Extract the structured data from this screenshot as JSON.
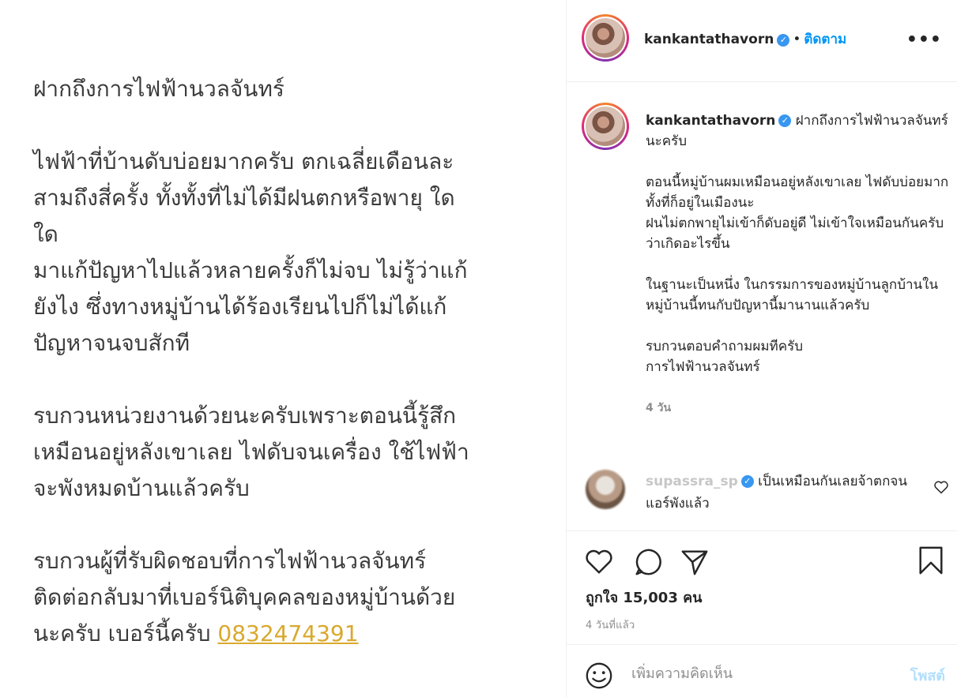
{
  "post_image": {
    "lines": [
      "ฝากถึงการไฟฟ้านวลจันทร์",
      "ไฟฟ้าที่บ้านดับบ่อยมากครับ ตกเฉลี่ยเดือนละ\nสามถึงสี่ครั้ง ทั้งทั้งที่ไม่ได้มีฝนตกหรือพายุ ใด\nใด\nมาแก้ปัญหาไปแล้วหลายครั้งก็ไม่จบ ไม่รู้ว่าแก้\nยังไง ซึ่งทางหมู่บ้านได้ร้องเรียนไปก็ไม่ได้แก้\nปัญหาจนจบสักที",
      "รบกวนหน่วยงานด้วยนะครับเพราะตอนนี้รู้สึก\nเหมือนอยู่หลังเขาเลย ไฟดับจนเครื่อง ใช้ไฟฟ้า\nจะพังหมดบ้านแล้วครับ",
      "รบกวนผู้ที่รับผิดชอบที่การไฟฟ้านวลจันทร์\nติดต่อกลับมาที่เบอร์นิติบุคคลของหมู่บ้านด้วย\nนะครับ เบอร์นี้ครับ "
    ],
    "phone": "0832474391"
  },
  "header": {
    "username": "kankantathavorn",
    "verified": "✓",
    "dot": "•",
    "follow_label": "ติดตาม",
    "more": "•••"
  },
  "caption": {
    "username": "kankantathavorn",
    "verified": "✓",
    "first_line": "ฝากถึงการไฟฟ้านวลจันทร์นะครับ",
    "paragraphs": [
      "ตอนนี้หมู่บ้านผมเหมือนอยู่หลังเขาเลย ไฟดับบ่อยมากทั้งที่ก็อยู่ในเมืองนะ\nฝนไม่ตกพายุไม่เข้าก็ดับอยู่ดี ไม่เข้าใจเหมือนกันครับว่าเกิดอะไรขึ้น",
      "ในฐานะเป็นหนึ่ง ในกรรมการของหมู่บ้านลูกบ้านในหมู่บ้านนี้ทนกับปัญหานี้มานานแล้วครับ",
      "รบกวนตอบคำถามผมทีครับ\nการไฟฟ้านวลจันทร์"
    ],
    "time": "4 วัน"
  },
  "comment": {
    "username": "supassra_sp",
    "verified": "✓",
    "text": "เป็นเหมือนกันเลยจ้าตกจนแอร์พังแล้ว"
  },
  "actions": {
    "likes": "ถูกใจ 15,003 คน",
    "post_time": "4 วันที่แล้ว",
    "comment_placeholder": "เพิ่มความคิดเห็น",
    "post_label": "โพสต์"
  },
  "colors": {
    "follow": "#0095f6",
    "verified": "#3897f0",
    "phone_link": "#d9a92e",
    "post_disabled": "#b2dffc"
  }
}
